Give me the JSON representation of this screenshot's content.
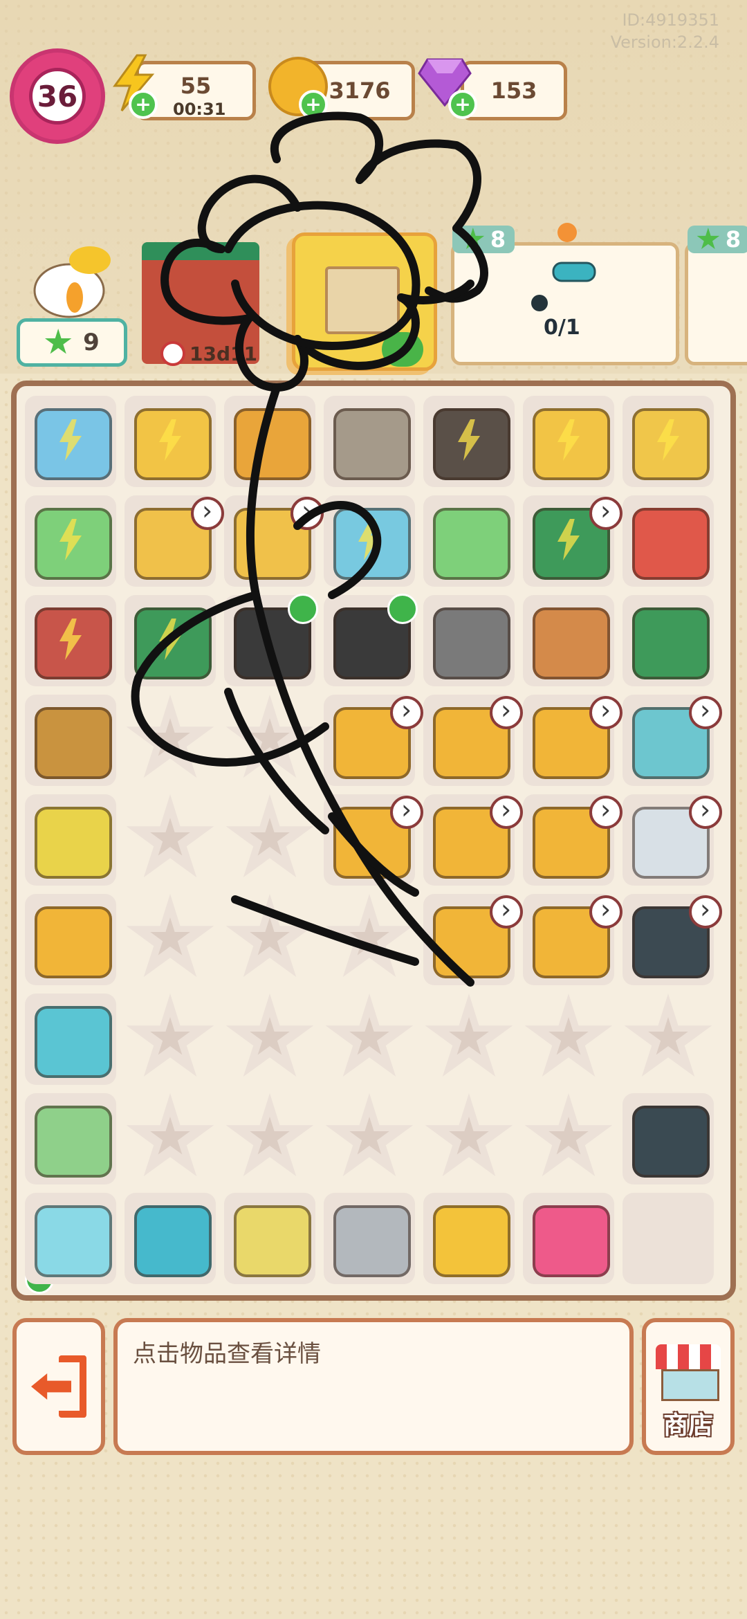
{
  "meta": {
    "id_label": "ID:4919351",
    "version_label": "Version:2.2.4"
  },
  "player": {
    "level": "36"
  },
  "resources": {
    "energy": {
      "value": "55",
      "timer": "00:31",
      "color": "#f7c51e"
    },
    "coins": {
      "value": "3176",
      "color": "#f2b42b"
    },
    "gems": {
      "value": "153",
      "color": "#b45ad6"
    }
  },
  "stars": {
    "count": "9"
  },
  "building": {
    "timer": "13d11"
  },
  "orders": [
    {
      "reward": "8",
      "progress": "0/1"
    },
    {
      "reward": "8"
    }
  ],
  "info_panel": {
    "text": "点击物品查看详情"
  },
  "shop": {
    "label": "商店"
  },
  "board_items": [
    "treadmill-icon",
    "bucket-icon",
    "locker-small-icon",
    "locker-large-icon",
    "bag-icon",
    "bucket-icon",
    "plant-pot-icon",
    "laptop-icon",
    "shopping-cart-icon",
    "shopping-cart-icon",
    "robot-vacuum-icon",
    "laptop-icon",
    "basket-icon",
    "popcorn-box-icon",
    "wheelbarrow-icon",
    "toolbox-icon",
    "duffel-bag-icon",
    "duffel-bag-icon",
    "caster-wheel-icon",
    "potato-icon",
    "toolbox-icon",
    "wicker-basket-icon",
    "box-icon",
    "box-icon",
    "box-icon",
    "bench-icon",
    "weights-cart-icon",
    "box-icon",
    "box-icon",
    "box-icon",
    "dumbbell-icon",
    "box-icon",
    "box-icon",
    "box-icon",
    "weight-plates-icon",
    "ab-board-icon",
    "cash-icon",
    "ab-roller-icon",
    "dumbbell-small-icon",
    "hula-hoop-icon",
    "jump-rope-icon",
    "chest-expander-icon",
    "medal-icon",
    "backpack-icon"
  ]
}
